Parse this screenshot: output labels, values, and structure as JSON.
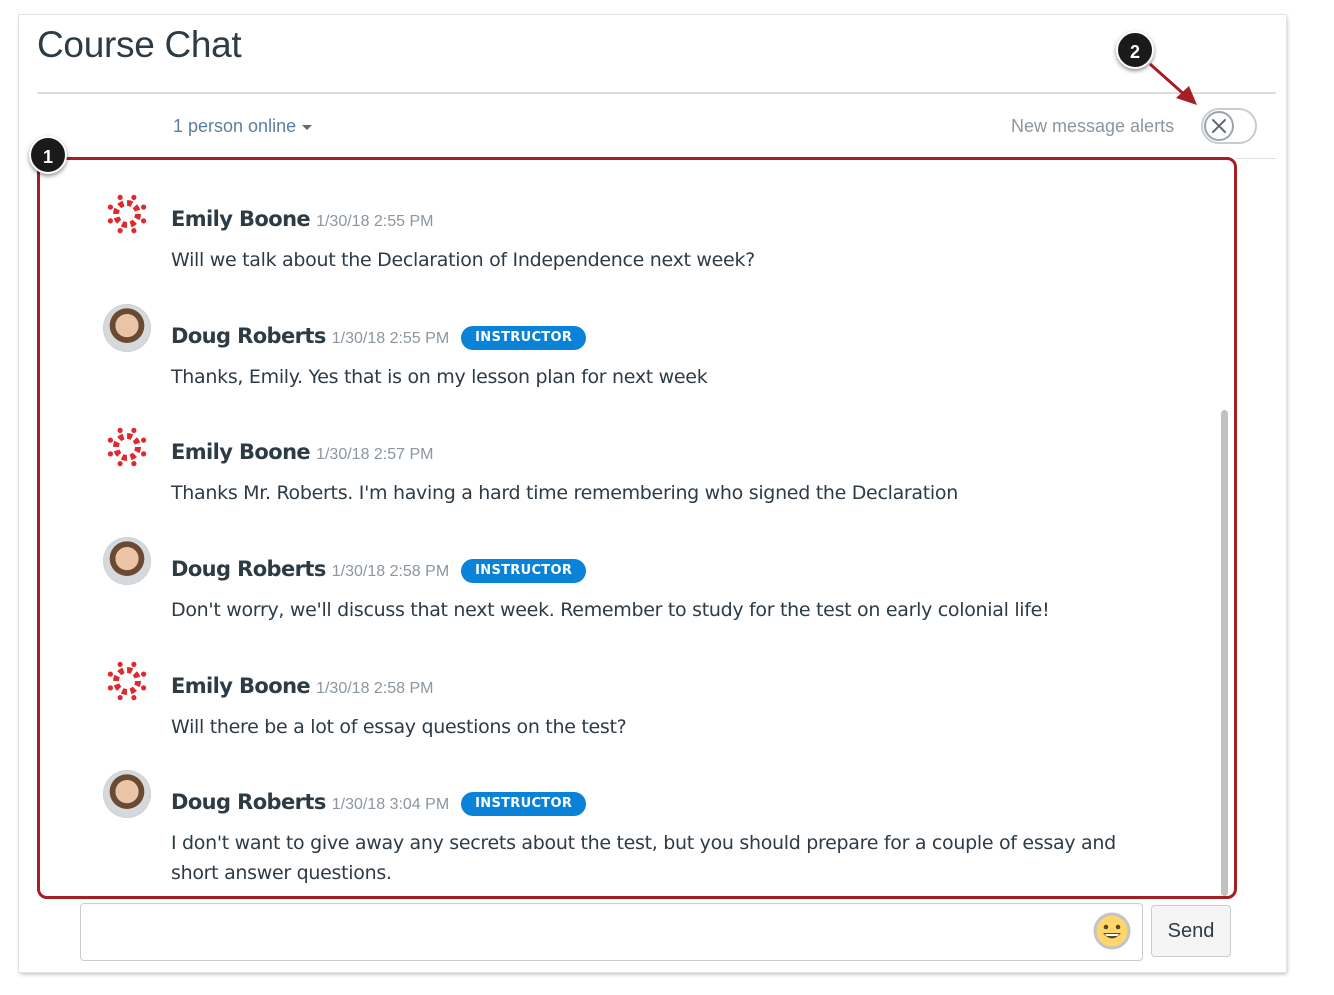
{
  "header": {
    "title": "Course Chat",
    "online_label": "1 person online",
    "alerts_label": "New message alerts",
    "alerts_toggle_state": "off"
  },
  "callouts": [
    "1",
    "2"
  ],
  "messages": [
    {
      "author": "Emily Boone",
      "time": "1/30/18 2:55 PM",
      "badge": "",
      "avatar": "canvas-logo",
      "text": "Will we talk about the Declaration of Independence next week?"
    },
    {
      "author": "Doug Roberts",
      "time": "1/30/18 2:55 PM",
      "badge": "INSTRUCTOR",
      "avatar": "photo",
      "text": "Thanks, Emily. Yes that is on my lesson plan for next week"
    },
    {
      "author": "Emily Boone",
      "time": "1/30/18 2:57 PM",
      "badge": "",
      "avatar": "canvas-logo",
      "text": "Thanks Mr. Roberts. I'm having a hard time remembering who signed the Declaration"
    },
    {
      "author": "Doug Roberts",
      "time": "1/30/18 2:58 PM",
      "badge": "INSTRUCTOR",
      "avatar": "photo",
      "text": "Don't worry, we'll discuss that next week. Remember to study for the test on early colonial life!"
    },
    {
      "author": "Emily Boone",
      "time": "1/30/18 2:58 PM",
      "badge": "",
      "avatar": "canvas-logo",
      "text": "Will there be a lot of essay questions on the test?"
    },
    {
      "author": "Doug Roberts",
      "time": "1/30/18 3:04 PM",
      "badge": "INSTRUCTOR",
      "avatar": "photo",
      "text": "I don't want to give away any secrets about the test, but you should prepare for a couple of essay and short answer questions."
    }
  ],
  "composer": {
    "value": "",
    "emoji_icon": "smiley-face-icon",
    "send_label": "Send"
  },
  "colors": {
    "highlight_border": "#a51e24",
    "instructor_badge": "#0a82d8",
    "canvas_logo": "#e0292d"
  }
}
